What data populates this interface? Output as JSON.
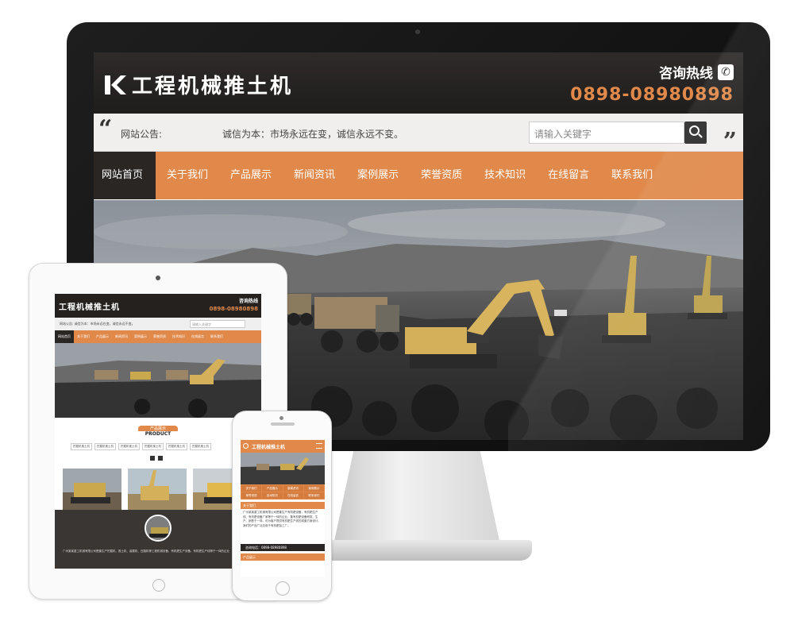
{
  "desktop": {
    "logo_text": "工程机械推土机",
    "hotline_label": "咨询热线",
    "hotline_number": "0898-08980898",
    "notice_label": "网站公告:",
    "notice_text": "诚信为本：市场永远在变，诚信永远不变。",
    "search_placeholder": "请输入关键字",
    "nav": [
      "网站首页",
      "关于我们",
      "产品展示",
      "新闻资讯",
      "案例展示",
      "荣誉资质",
      "技术知识",
      "在线留言",
      "联系我们"
    ],
    "accent_color": "#e0894a",
    "header_color": "#24211f"
  },
  "tablet": {
    "logo_text": "工程机械推土机",
    "hotline_label": "咨询热线",
    "hotline_number": "0898-08980898",
    "notice_text": "网站公告: 诚信为本：市场永远在变，诚信永远不变。",
    "search_placeholder": "请输入关键字",
    "nav": [
      "网站首页",
      "关于我们",
      "产品展示",
      "新闻资讯",
      "案例展示",
      "荣誉资质",
      "技术知识",
      "在线留言",
      "联系我们"
    ],
    "product_cn": "产品展示",
    "product_en": "PRODUCT",
    "product_tabs": [
      "挖掘机推土机",
      "挖掘机推土机",
      "挖掘机推土机",
      "挖掘机推土机",
      "挖掘机推土机",
      "挖掘机推土机"
    ],
    "product_cards": [
      "产品展示推土机",
      "产品展示推土机",
      "产品展示推土机"
    ],
    "about_text": "广州某某重工机械有限公司是集生产挖掘机、推土机、装载机、压路机等工程机械设备、有机肥生产设备、有机肥生产线等于一体的企业"
  },
  "phone": {
    "logo_text": "工程机械推土机",
    "nav": [
      "关于我们",
      "产品展示",
      "新闻资讯",
      "案例展示",
      "荣誉资质",
      "技术知识",
      "在线留言",
      "联系我们"
    ],
    "about_title": "关于我们",
    "about_text": "广州某某重工机械有限公司是集生产有机肥设备、有机肥生产线、有机肥设备厂家等于一体的企业，集有机肥设备研发、生产、销售于一体，可为客户提供有机肥生产线的成套方案设计。我们的产品广泛应用于有机肥加工厂。",
    "contact_label": "咨询电话：0898-08980898",
    "products_title": "产品展示"
  }
}
